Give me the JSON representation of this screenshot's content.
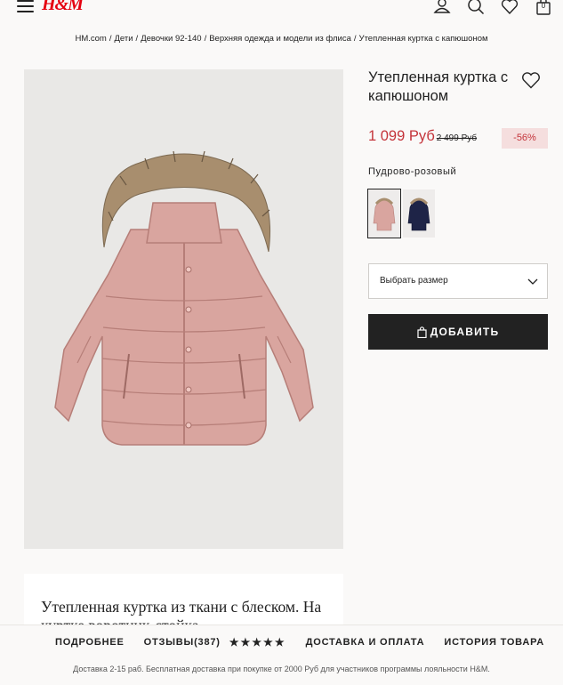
{
  "header": {
    "logo": "H&M",
    "cart_count": "0"
  },
  "breadcrumb": [
    "HM.com",
    "Дети",
    "Девочки 92-140",
    "Верхняя одежда и модели из флиса",
    "Утепленная куртка с капюшоном"
  ],
  "product": {
    "title": "Утепленная куртка с капюшоном",
    "price_now": "1 099 Руб",
    "price_old": "2 499 Руб",
    "discount": "-56%",
    "color_name": "Пудрово-розовый",
    "swatch_colors": [
      "#d9a59f",
      "#1e2447"
    ],
    "size_placeholder": "Выбрать размер",
    "add_label": "ДОБАВИТЬ",
    "description": "Утепленная куртка из ткани с блеском. На куртке воротник-стойка,"
  },
  "bottom": {
    "tabs": [
      "ПОДРОБНЕЕ",
      "ОТЗЫВЫ(387)",
      "ДОСТАВКА И ОПЛАТА",
      "ИСТОРИЯ ТОВАРА"
    ],
    "stars": "★★★★★",
    "promo": "Доставка 2-15 раб. Бесплатная доставка при покупке от 2000 Руб для участников программы лояльности H&M."
  },
  "colors": {
    "accent_red": "#c4343a",
    "brand_red": "#e50010",
    "jacket": "#d9a59f"
  }
}
